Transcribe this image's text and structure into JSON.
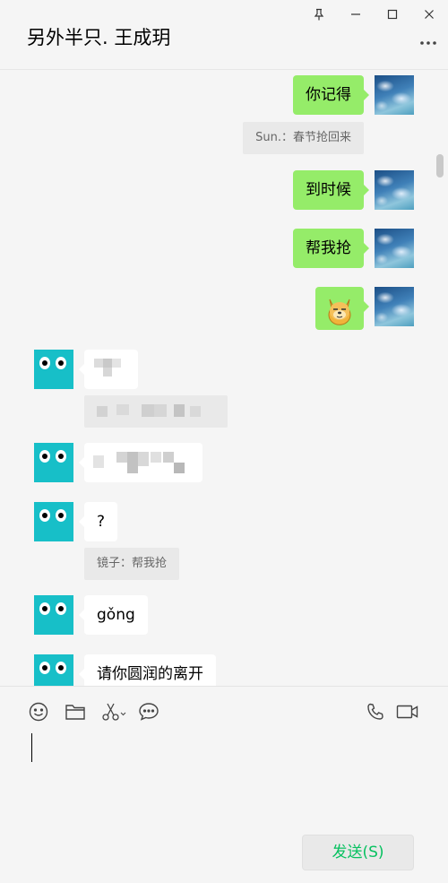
{
  "chat": {
    "title": "另外半只. 王成玥"
  },
  "window_controls": {
    "pin_icon": "pin-icon",
    "minimize_icon": "minimize-icon",
    "maximize_icon": "maximize-icon",
    "close_icon": "close-icon",
    "more_icon": "more-dots-icon"
  },
  "messages": {
    "m1_text": "你记得",
    "m1_quote": "Sun.：春节抢回来",
    "m2_text": "到时候",
    "m3_text": "帮我抢",
    "m4_emoji": "doge-sticker",
    "m7_text": "?",
    "m7_quote": "镜子：帮我抢",
    "m8_text": "gǒng",
    "m9_text": "请你圆润的离开"
  },
  "toolbar": {
    "emoji_icon": "emoji-icon",
    "file_icon": "folder-icon",
    "screenshot_icon": "scissors-icon",
    "chat_history_icon": "chat-bubble-icon",
    "voice_call_icon": "phone-icon",
    "video_call_icon": "video-icon"
  },
  "composer": {
    "value": "",
    "send_label": "发送(S)"
  },
  "colors": {
    "my_bubble": "#95ec69",
    "their_bubble": "#ffffff",
    "send_text": "#07c160",
    "background": "#f5f5f5"
  }
}
